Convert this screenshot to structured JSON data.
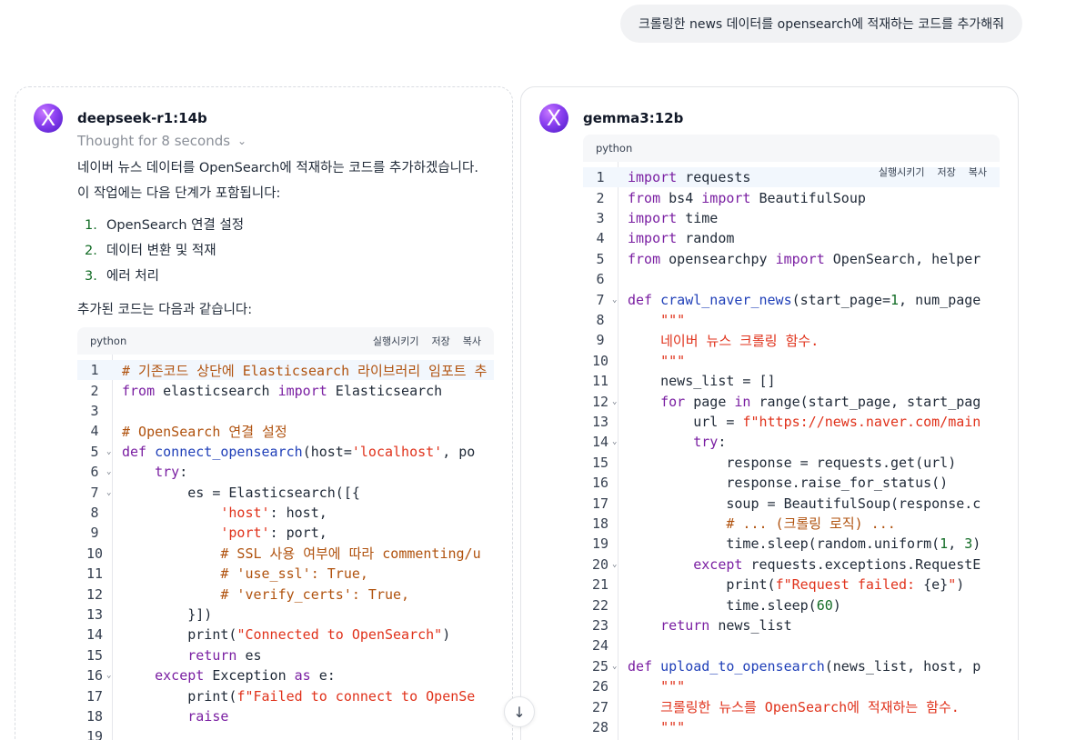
{
  "user_message": "크롤링한 news 데이터를 opensearch에 적재하는 코드를 추가해줘",
  "left": {
    "model_name": "deepseek-r1:14b",
    "thought_label": "Thought for 8 seconds",
    "intro_line1": "네이버 뉴스 데이터를 OpenSearch에 적재하는 코드를 추가하겠습니다.",
    "intro_line2": "이 작업에는 다음 단계가 포함됩니다:",
    "steps": [
      {
        "num": "1.",
        "text": "OpenSearch 연결 설정"
      },
      {
        "num": "2.",
        "text": "데이터 변환 및 적재"
      },
      {
        "num": "3.",
        "text": "에러 처리"
      }
    ],
    "code_intro": "추가된 코드는 다음과 같습니다:",
    "code": {
      "language": "python",
      "actions": [
        "실행시키기",
        "저장",
        "복사"
      ],
      "lines": [
        {
          "n": "1",
          "fold": false,
          "tokens": [
            [
              "cmt",
              "# 기존코드 상단에 Elasticsearch 라이브러리 임포트 추"
            ]
          ]
        },
        {
          "n": "2",
          "fold": false,
          "tokens": [
            [
              "kw",
              "from"
            ],
            [
              "plain",
              " elasticsearch "
            ],
            [
              "kw",
              "import"
            ],
            [
              "plain",
              " Elasticsearch"
            ]
          ]
        },
        {
          "n": "3",
          "fold": false,
          "tokens": []
        },
        {
          "n": "4",
          "fold": false,
          "tokens": [
            [
              "cmt",
              "# OpenSearch 연결 설정"
            ]
          ]
        },
        {
          "n": "5",
          "fold": true,
          "tokens": [
            [
              "kw",
              "def"
            ],
            [
              "plain",
              " "
            ],
            [
              "fn",
              "connect_opensearch"
            ],
            [
              "plain",
              "(host="
            ],
            [
              "str",
              "'localhost'"
            ],
            [
              "plain",
              ", po"
            ]
          ]
        },
        {
          "n": "6",
          "fold": true,
          "tokens": [
            [
              "plain",
              "    "
            ],
            [
              "kw",
              "try"
            ],
            [
              "plain",
              ":"
            ]
          ]
        },
        {
          "n": "7",
          "fold": true,
          "tokens": [
            [
              "plain",
              "        es = Elasticsearch([{"
            ]
          ]
        },
        {
          "n": "8",
          "fold": false,
          "tokens": [
            [
              "plain",
              "            "
            ],
            [
              "str",
              "'host'"
            ],
            [
              "plain",
              ": host,"
            ]
          ]
        },
        {
          "n": "9",
          "fold": false,
          "tokens": [
            [
              "plain",
              "            "
            ],
            [
              "str",
              "'port'"
            ],
            [
              "plain",
              ": port,"
            ]
          ]
        },
        {
          "n": "10",
          "fold": false,
          "tokens": [
            [
              "plain",
              "            "
            ],
            [
              "cmt",
              "# SSL 사용 여부에 따라 commenting/u"
            ]
          ]
        },
        {
          "n": "11",
          "fold": false,
          "tokens": [
            [
              "plain",
              "            "
            ],
            [
              "cmt",
              "# 'use_ssl': True,"
            ]
          ]
        },
        {
          "n": "12",
          "fold": false,
          "tokens": [
            [
              "plain",
              "            "
            ],
            [
              "cmt",
              "# 'verify_certs': True,"
            ]
          ]
        },
        {
          "n": "13",
          "fold": false,
          "tokens": [
            [
              "plain",
              "        }])"
            ]
          ]
        },
        {
          "n": "14",
          "fold": false,
          "tokens": [
            [
              "plain",
              "        print("
            ],
            [
              "str",
              "\"Connected to OpenSearch\""
            ],
            [
              "plain",
              ")"
            ]
          ]
        },
        {
          "n": "15",
          "fold": false,
          "tokens": [
            [
              "plain",
              "        "
            ],
            [
              "kw",
              "return"
            ],
            [
              "plain",
              " es"
            ]
          ]
        },
        {
          "n": "16",
          "fold": true,
          "tokens": [
            [
              "plain",
              "    "
            ],
            [
              "kw",
              "except"
            ],
            [
              "plain",
              " Exception "
            ],
            [
              "kw",
              "as"
            ],
            [
              "plain",
              " e:"
            ]
          ]
        },
        {
          "n": "17",
          "fold": false,
          "tokens": [
            [
              "plain",
              "        print("
            ],
            [
              "str",
              "f\"Failed to connect to OpenSe"
            ]
          ]
        },
        {
          "n": "18",
          "fold": false,
          "tokens": [
            [
              "plain",
              "        "
            ],
            [
              "kw",
              "raise"
            ]
          ]
        },
        {
          "n": "19",
          "fold": false,
          "tokens": []
        }
      ]
    }
  },
  "right": {
    "model_name": "gemma3:12b",
    "code": {
      "language": "python",
      "actions": [
        "실행시키기",
        "저장",
        "복사"
      ],
      "lines": [
        {
          "n": "1",
          "fold": false,
          "tokens": [
            [
              "kw",
              "import"
            ],
            [
              "plain",
              " requests"
            ]
          ]
        },
        {
          "n": "2",
          "fold": false,
          "tokens": [
            [
              "kw",
              "from"
            ],
            [
              "plain",
              " bs4 "
            ],
            [
              "kw",
              "import"
            ],
            [
              "plain",
              " BeautifulSoup"
            ]
          ]
        },
        {
          "n": "3",
          "fold": false,
          "tokens": [
            [
              "kw",
              "import"
            ],
            [
              "plain",
              " time"
            ]
          ]
        },
        {
          "n": "4",
          "fold": false,
          "tokens": [
            [
              "kw",
              "import"
            ],
            [
              "plain",
              " random"
            ]
          ]
        },
        {
          "n": "5",
          "fold": false,
          "tokens": [
            [
              "kw",
              "from"
            ],
            [
              "plain",
              " opensearchpy "
            ],
            [
              "kw",
              "import"
            ],
            [
              "plain",
              " OpenSearch, helper"
            ]
          ]
        },
        {
          "n": "6",
          "fold": false,
          "tokens": []
        },
        {
          "n": "7",
          "fold": true,
          "tokens": [
            [
              "kw",
              "def"
            ],
            [
              "plain",
              " "
            ],
            [
              "fn",
              "crawl_naver_news"
            ],
            [
              "plain",
              "(start_page="
            ],
            [
              "num",
              "1"
            ],
            [
              "plain",
              ", num_page"
            ]
          ]
        },
        {
          "n": "8",
          "fold": false,
          "tokens": [
            [
              "plain",
              "    "
            ],
            [
              "str",
              "\"\"\""
            ]
          ]
        },
        {
          "n": "9",
          "fold": false,
          "tokens": [
            [
              "plain",
              "    "
            ],
            [
              "str",
              "네이버 뉴스 크롤링 함수."
            ]
          ]
        },
        {
          "n": "10",
          "fold": false,
          "tokens": [
            [
              "plain",
              "    "
            ],
            [
              "str",
              "\"\"\""
            ]
          ]
        },
        {
          "n": "11",
          "fold": false,
          "tokens": [
            [
              "plain",
              "    news_list = []"
            ]
          ]
        },
        {
          "n": "12",
          "fold": true,
          "tokens": [
            [
              "plain",
              "    "
            ],
            [
              "kw",
              "for"
            ],
            [
              "plain",
              " page "
            ],
            [
              "kw",
              "in"
            ],
            [
              "plain",
              " range(start_page, start_pag"
            ]
          ]
        },
        {
          "n": "13",
          "fold": false,
          "tokens": [
            [
              "plain",
              "        url = "
            ],
            [
              "str",
              "f\"https://news.naver.com/main"
            ]
          ]
        },
        {
          "n": "14",
          "fold": true,
          "tokens": [
            [
              "plain",
              "        "
            ],
            [
              "kw",
              "try"
            ],
            [
              "plain",
              ":"
            ]
          ]
        },
        {
          "n": "15",
          "fold": false,
          "tokens": [
            [
              "plain",
              "            response = requests.get(url)"
            ]
          ]
        },
        {
          "n": "16",
          "fold": false,
          "tokens": [
            [
              "plain",
              "            response.raise_for_status()"
            ]
          ]
        },
        {
          "n": "17",
          "fold": false,
          "tokens": [
            [
              "plain",
              "            soup = BeautifulSoup(response.c"
            ]
          ]
        },
        {
          "n": "18",
          "fold": false,
          "tokens": [
            [
              "plain",
              "            "
            ],
            [
              "cmt",
              "# ... (크롤링 로직) ..."
            ]
          ]
        },
        {
          "n": "19",
          "fold": false,
          "tokens": [
            [
              "plain",
              "            time.sleep(random.uniform("
            ],
            [
              "num",
              "1"
            ],
            [
              "plain",
              ", "
            ],
            [
              "num",
              "3"
            ],
            [
              "plain",
              ")"
            ]
          ]
        },
        {
          "n": "20",
          "fold": true,
          "tokens": [
            [
              "plain",
              "        "
            ],
            [
              "kw",
              "except"
            ],
            [
              "plain",
              " requests.exceptions.RequestE"
            ]
          ]
        },
        {
          "n": "21",
          "fold": false,
          "tokens": [
            [
              "plain",
              "            print("
            ],
            [
              "str",
              "f\"Request failed: "
            ],
            [
              "plain",
              "{e}"
            ],
            [
              "str",
              "\""
            ],
            [
              "plain",
              ")"
            ]
          ]
        },
        {
          "n": "22",
          "fold": false,
          "tokens": [
            [
              "plain",
              "            time.sleep("
            ],
            [
              "num",
              "60"
            ],
            [
              "plain",
              ")"
            ]
          ]
        },
        {
          "n": "23",
          "fold": false,
          "tokens": [
            [
              "plain",
              "    "
            ],
            [
              "kw",
              "return"
            ],
            [
              "plain",
              " news_list"
            ]
          ]
        },
        {
          "n": "24",
          "fold": false,
          "tokens": []
        },
        {
          "n": "25",
          "fold": true,
          "tokens": [
            [
              "kw",
              "def"
            ],
            [
              "plain",
              " "
            ],
            [
              "fn",
              "upload_to_opensearch"
            ],
            [
              "plain",
              "(news_list, host, p"
            ]
          ]
        },
        {
          "n": "26",
          "fold": false,
          "tokens": [
            [
              "plain",
              "    "
            ],
            [
              "str",
              "\"\"\""
            ]
          ]
        },
        {
          "n": "27",
          "fold": false,
          "tokens": [
            [
              "plain",
              "    "
            ],
            [
              "str",
              "크롤링한 뉴스를 OpenSearch에 적재하는 함수."
            ]
          ]
        },
        {
          "n": "28",
          "fold": false,
          "tokens": [
            [
              "plain",
              "    "
            ],
            [
              "str",
              "\"\"\""
            ]
          ]
        }
      ]
    }
  },
  "colors": {
    "keyword": "#7a1fa2",
    "function": "#1f3fb8",
    "string": "#e0321b",
    "comment": "#b0520e",
    "number": "#116b24",
    "active_line": "#f2f7fd"
  },
  "scroll_icon": "arrow-down-icon"
}
